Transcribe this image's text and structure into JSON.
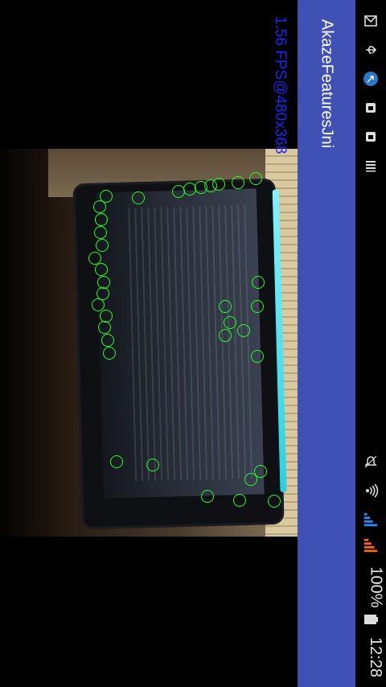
{
  "app": {
    "title": "AkazeFeaturesJni"
  },
  "overlay": {
    "fps_text": "1.56 FPS@480x368"
  },
  "status_bar": {
    "time": "12:28",
    "battery_percent": "100%",
    "icons": [
      "gmail-icon",
      "usb-icon",
      "browser-icon",
      "shop-icon",
      "shop-icon",
      "storage-icon",
      "alarm-off-icon",
      "wifi-icon",
      "signal-blue-icon",
      "signal-orange-icon",
      "battery-icon"
    ]
  },
  "colors": {
    "action_bar": "#3f51b5",
    "fps_text": "#1e25ff",
    "keypoints": "#22ff22"
  }
}
